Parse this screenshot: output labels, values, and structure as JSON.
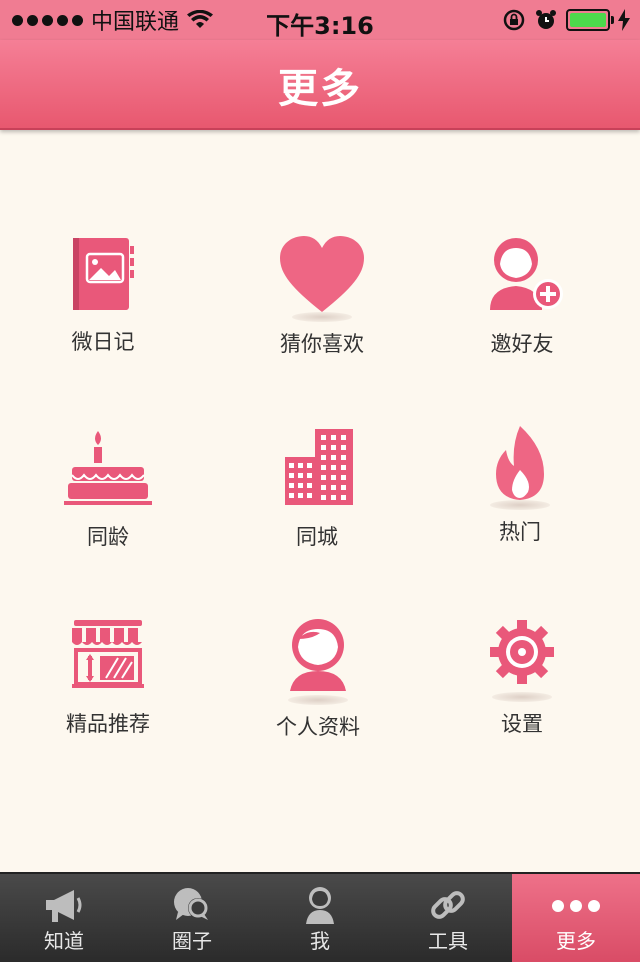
{
  "status_bar": {
    "carrier": "中国联通",
    "time": "下午3:16",
    "battery_level": 0.9
  },
  "nav": {
    "title": "更多"
  },
  "menu": [
    {
      "label": "微日记",
      "icon": "diary-book-icon"
    },
    {
      "label": "猜你喜欢",
      "icon": "heart-icon"
    },
    {
      "label": "邀好友",
      "icon": "add-friend-icon"
    },
    {
      "label": "同龄",
      "icon": "birthday-cake-icon"
    },
    {
      "label": "同城",
      "icon": "city-buildings-icon"
    },
    {
      "label": "热门",
      "icon": "flame-icon"
    },
    {
      "label": "精品推荐",
      "icon": "storefront-icon"
    },
    {
      "label": "个人资料",
      "icon": "profile-person-icon"
    },
    {
      "label": "设置",
      "icon": "settings-gear-icon"
    }
  ],
  "tabs": [
    {
      "label": "知道",
      "icon": "megaphone-icon"
    },
    {
      "label": "圈子",
      "icon": "chat-bubbles-icon"
    },
    {
      "label": "我",
      "icon": "user-icon"
    },
    {
      "label": "工具",
      "icon": "link-chain-icon"
    },
    {
      "label": "更多",
      "icon": "more-dots-icon",
      "active": true
    }
  ],
  "colors": {
    "accent": "#e8586f",
    "icon_pink": "#e9587a",
    "background": "#fdf8ef",
    "tabbar": "#333333"
  }
}
